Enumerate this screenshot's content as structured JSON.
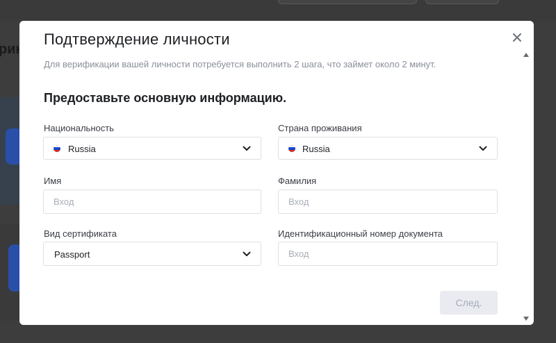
{
  "background": {
    "partial_heading": "рик"
  },
  "modal": {
    "title": "Подтверждение личности",
    "subtitle": "Для верификации вашей личности потребуется выполнить 2 шага, что займет около 2 минут.",
    "section_title": "Предоставьте основную информацию.",
    "fields": {
      "nationality": {
        "label": "Национальность",
        "value": "Russia",
        "flag": "ru-flag-icon"
      },
      "residence": {
        "label": "Страна проживания",
        "value": "Russia",
        "flag": "ru-flag-icon"
      },
      "first_name": {
        "label": "Имя",
        "placeholder": "Вход",
        "value": ""
      },
      "last_name": {
        "label": "Фамилия",
        "placeholder": "Вход",
        "value": ""
      },
      "doc_type": {
        "label": "Вид сертификата",
        "value": "Passport"
      },
      "doc_number": {
        "label": "Идентификационный номер документа",
        "placeholder": "Вход",
        "value": ""
      }
    },
    "next_label": "След.",
    "colors": {
      "accent_disabled_bg": "#e9ebf1",
      "accent_disabled_text": "#a6abb5",
      "title": "#1d1f23",
      "subtitle": "#8a8f99"
    }
  }
}
